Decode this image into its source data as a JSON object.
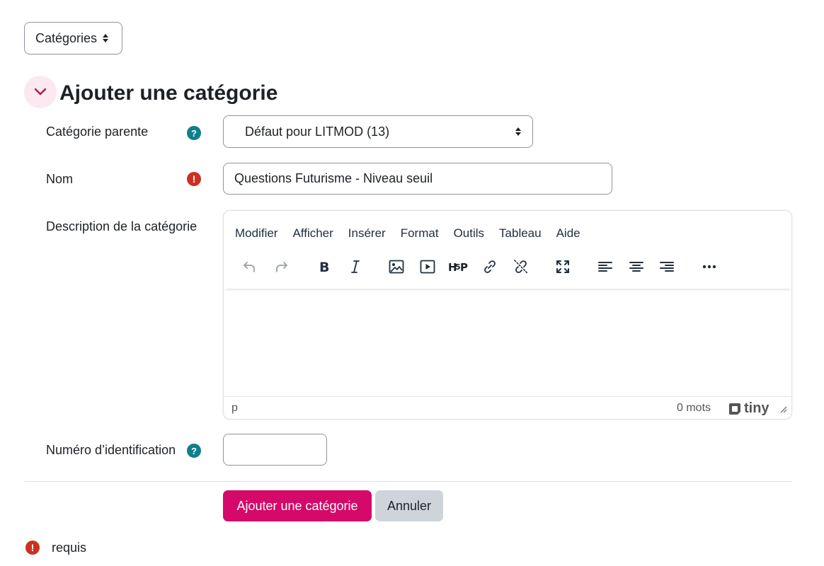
{
  "top_select": {
    "value": "Catégories"
  },
  "section": {
    "title": "Ajouter une catégorie"
  },
  "form": {
    "parent": {
      "label": "Catégorie parente",
      "value": "Défaut pour LITMOD (13)"
    },
    "name": {
      "label": "Nom",
      "value": "Questions Futurisme - Niveau seuil"
    },
    "description": {
      "label": "Description de la catégorie"
    },
    "idnumber": {
      "label": "Numéro d’identification",
      "value": ""
    }
  },
  "editor": {
    "menus": [
      "Modifier",
      "Afficher",
      "Insérer",
      "Format",
      "Outils",
      "Tableau",
      "Aide"
    ],
    "status_path": "p",
    "word_count": "0 mots",
    "brand": "tiny"
  },
  "buttons": {
    "submit": "Ajouter une catégorie",
    "cancel": "Annuler"
  },
  "legend": {
    "required": "requis"
  },
  "colors": {
    "primary": "#d40969",
    "help": "#0f7f8c",
    "required": "#ca3120"
  }
}
